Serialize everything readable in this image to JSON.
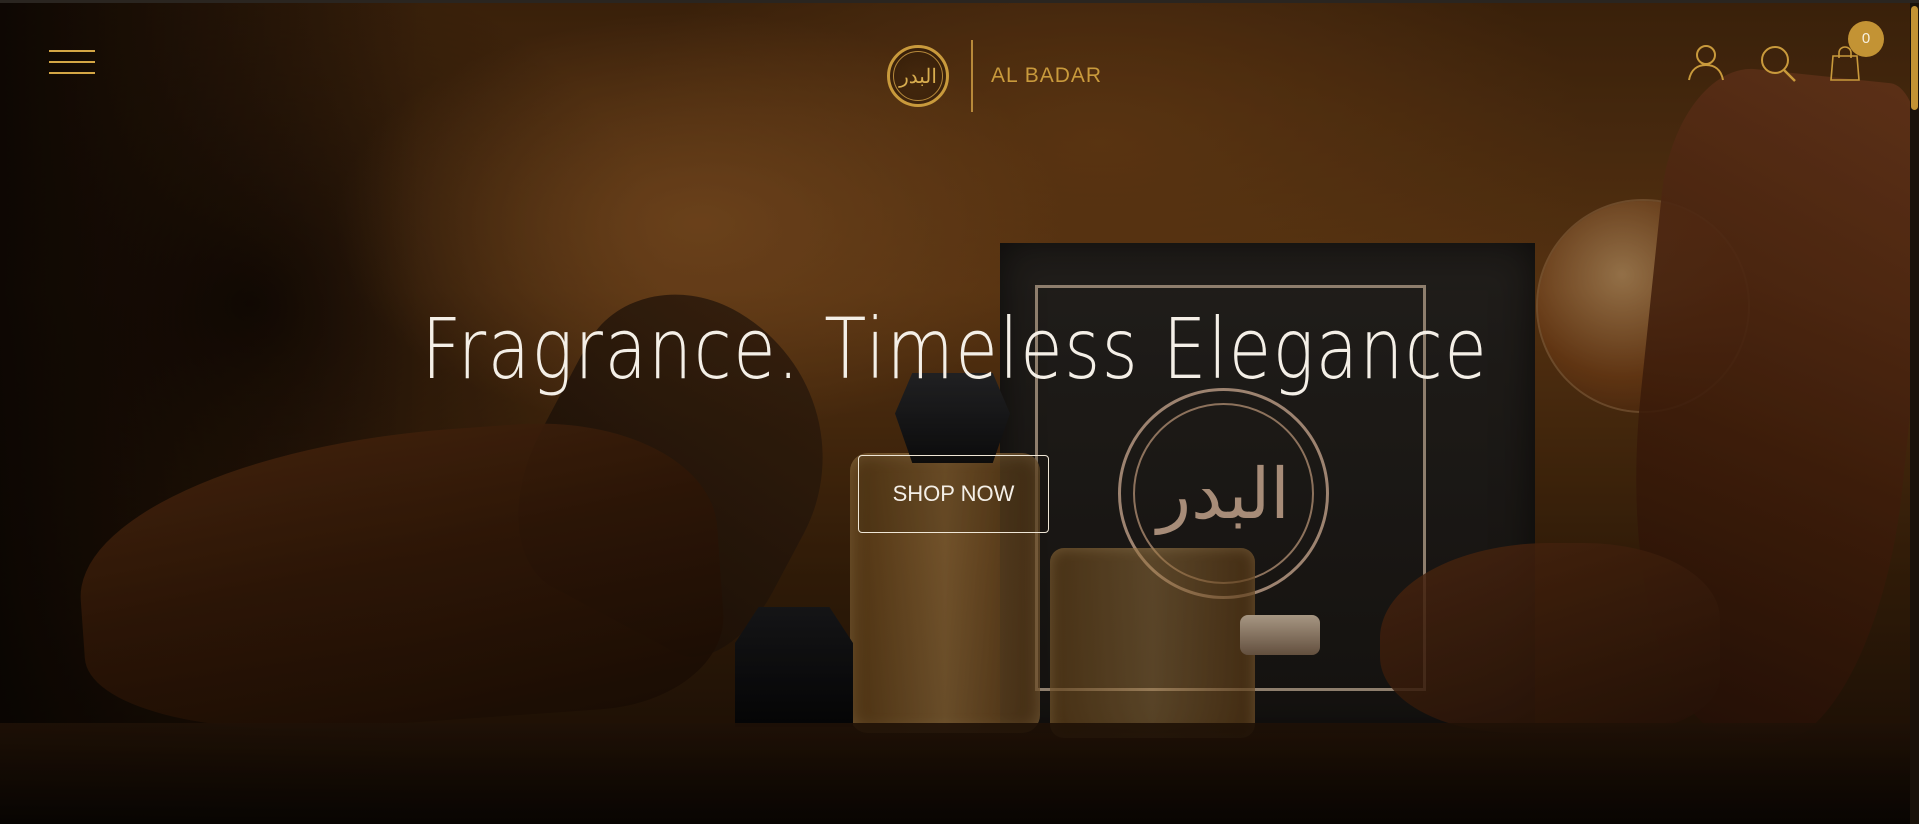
{
  "header": {
    "brand_name": "AL BADAR",
    "logo_glyph": "البدر",
    "cart_count": "0"
  },
  "hero": {
    "title": "Fragrance. Timeless Elegance",
    "cta_label": "SHOP NOW",
    "box_glyph": "البدر"
  },
  "icons": {
    "menu": "hamburger-menu-icon",
    "account": "user-icon",
    "search": "search-icon",
    "cart": "shopping-bag-icon"
  },
  "colors": {
    "accent_gold": "#c99a3c",
    "badge_gold": "#c39334",
    "hero_text": "#f4efe7"
  }
}
